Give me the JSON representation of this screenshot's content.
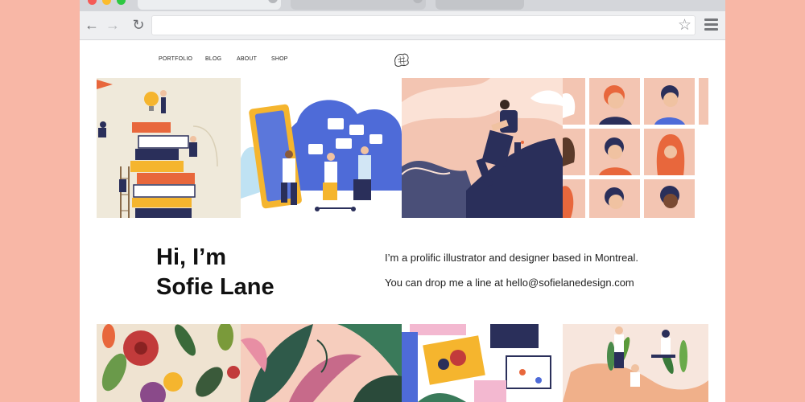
{
  "browser": {
    "tab_close_glyph": "×",
    "back_glyph": "←",
    "forward_glyph": "→",
    "reload_glyph": "↻",
    "star_glyph": "☆",
    "url": ""
  },
  "site": {
    "nav": [
      {
        "label": "PORTFOLIO"
      },
      {
        "label": "BLOG"
      },
      {
        "label": "ABOUT"
      },
      {
        "label": "SHOP"
      }
    ],
    "intro": {
      "title_line1": "Hi, I’m",
      "title_line2": "Sofie Lane",
      "line1": "I’m a prolific illustrator and designer based in Montreal.",
      "line2": "You can drop me a line at hello@sofielanedesign.com"
    },
    "gallery_top": [
      {
        "name": "books-ladder-illustration"
      },
      {
        "name": "phone-scooter-illustration"
      },
      {
        "name": "mountain-hiker-illustration"
      },
      {
        "name": "portrait-grid-illustration"
      }
    ],
    "gallery_bottom": [
      {
        "name": "fruit-leaves-pattern"
      },
      {
        "name": "tropical-leaves-pattern"
      },
      {
        "name": "desk-objects-illustration"
      },
      {
        "name": "plants-people-illustration"
      }
    ]
  },
  "colors": {
    "page_bg": "#f8b7a6",
    "accent_orange": "#e8673c",
    "navy": "#2a2f5a",
    "peach": "#f3c5b2"
  }
}
